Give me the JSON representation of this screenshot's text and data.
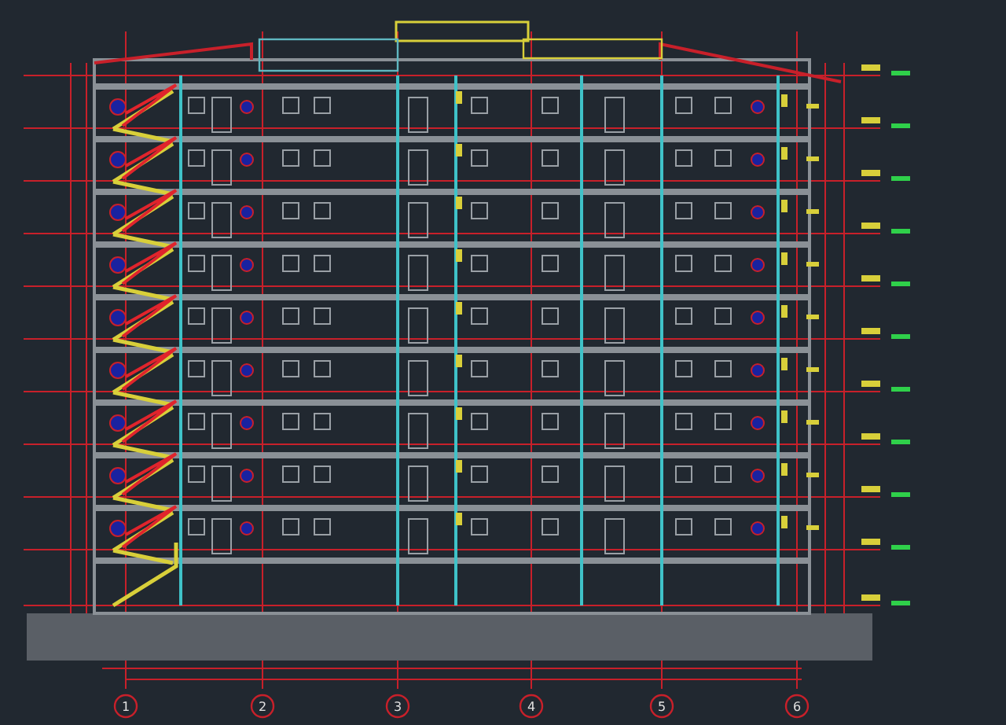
{
  "drawing": {
    "grid_axes": [
      {
        "label": "1"
      },
      {
        "label": "2"
      },
      {
        "label": "3"
      },
      {
        "label": "4"
      },
      {
        "label": "5"
      },
      {
        "label": "6"
      }
    ]
  }
}
